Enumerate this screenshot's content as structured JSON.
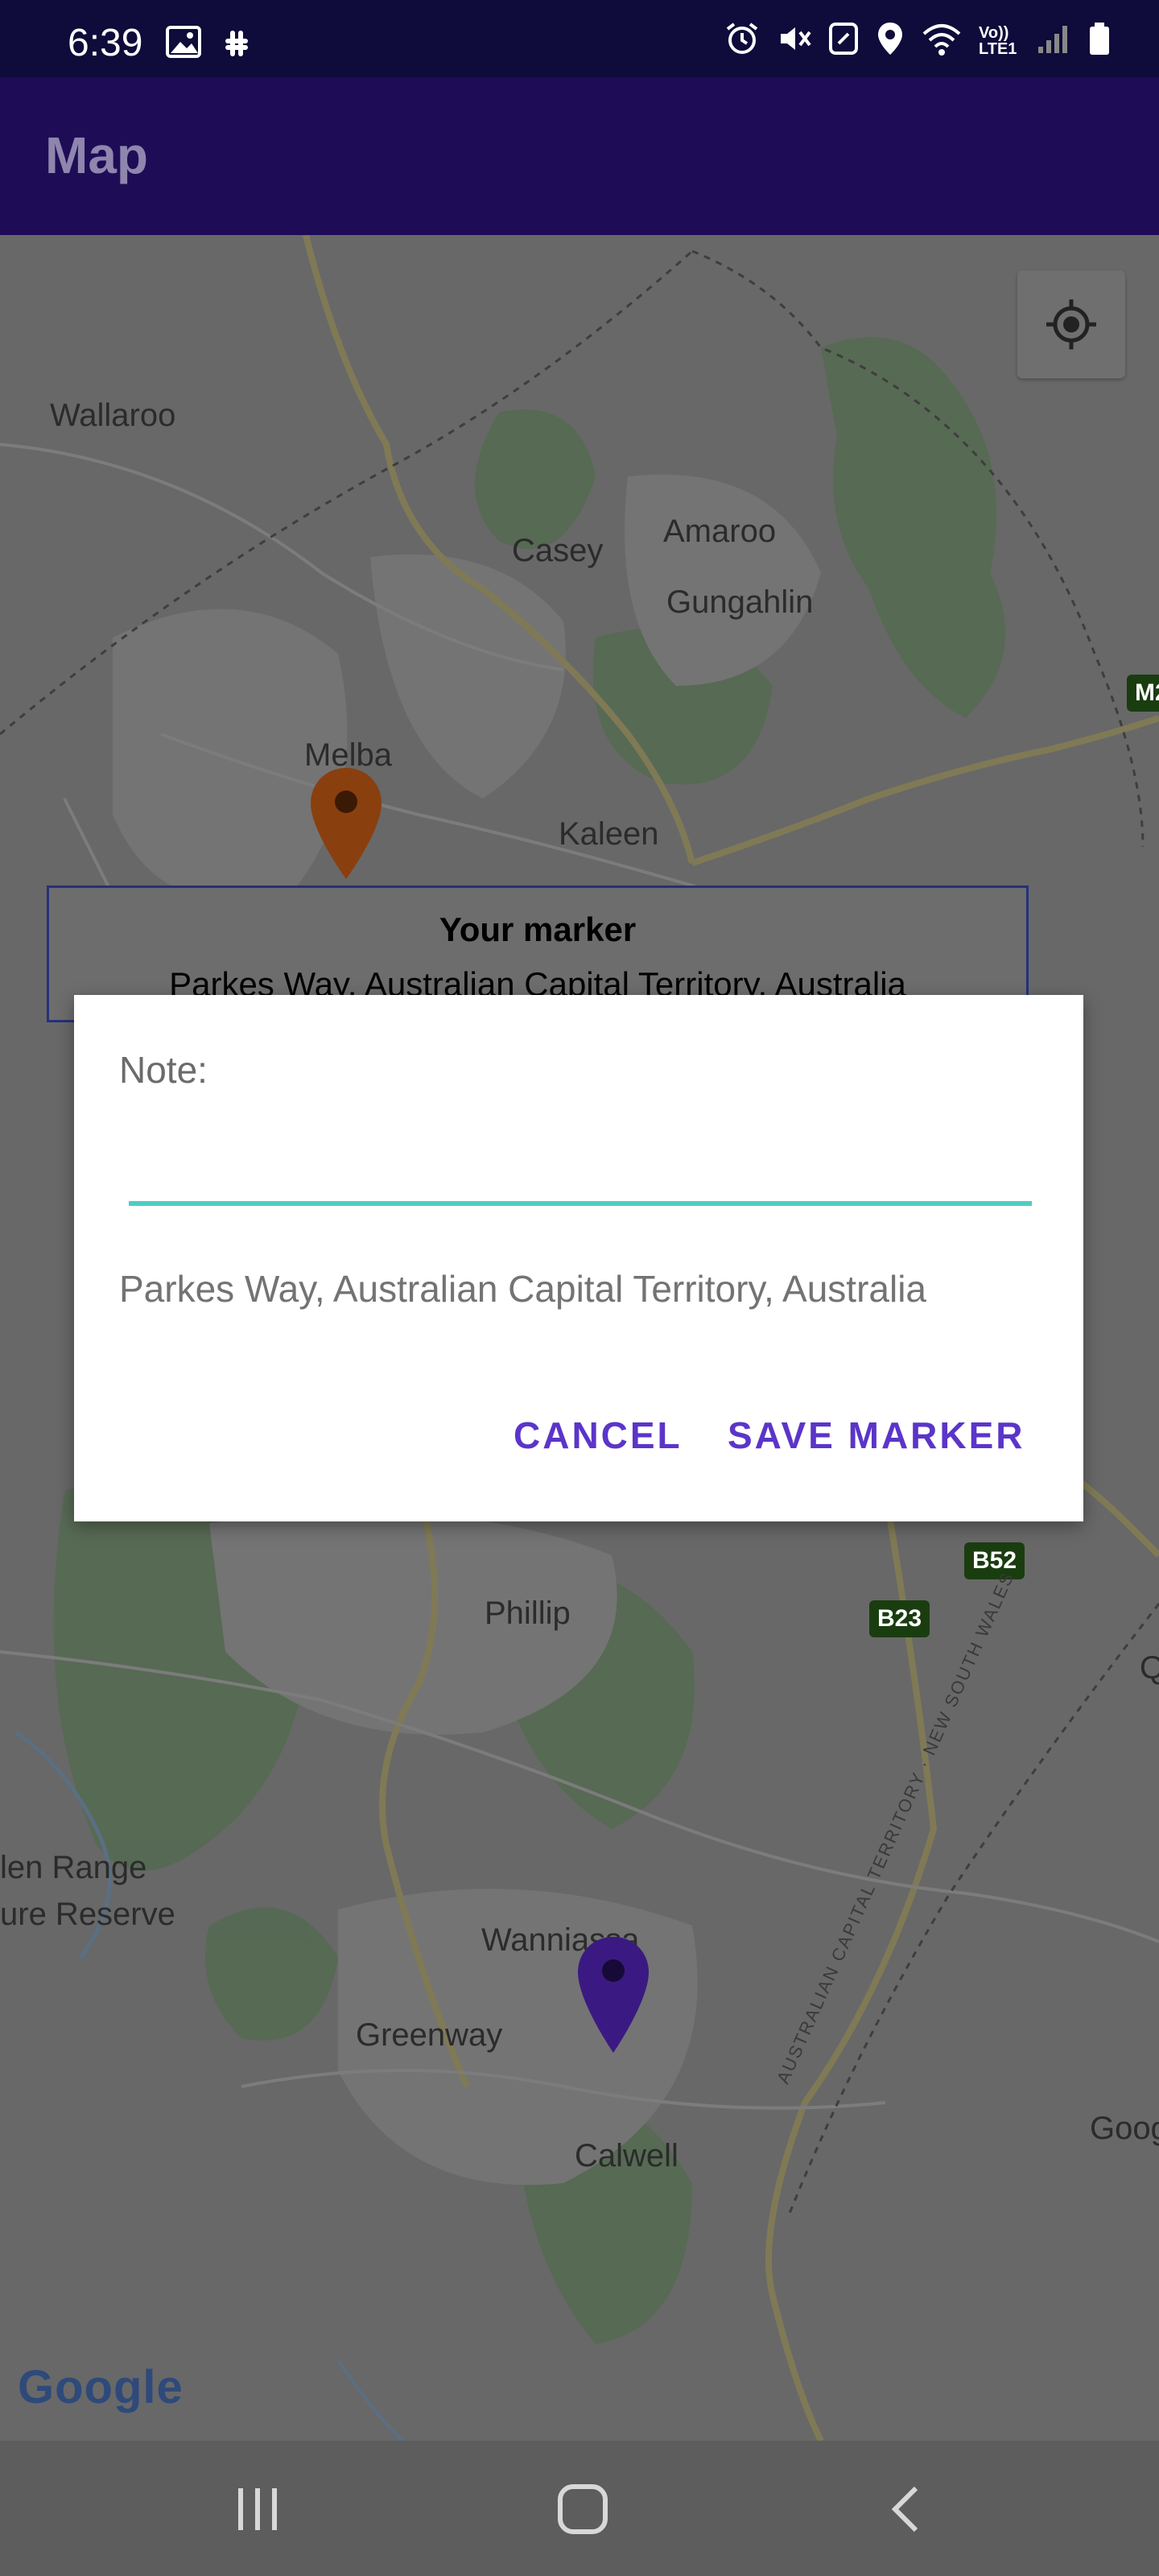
{
  "status_bar": {
    "time": "6:39",
    "left_icons": [
      "image-icon",
      "slack-icon"
    ],
    "right_icons": [
      "alarm-icon",
      "mute-icon",
      "nfc-icon",
      "location-icon",
      "wifi-icon",
      "volte-icon",
      "signal-icon",
      "battery-icon"
    ],
    "volte_text": "Vo)) LTE1"
  },
  "app_bar": {
    "title": "Map"
  },
  "map": {
    "labels": [
      "Wallaroo",
      "Casey",
      "Amaroo",
      "Gungahlin",
      "Melba",
      "Kaleen",
      "Phillip",
      "len Range",
      "ure Reserve",
      "Wanniassa",
      "Greenway",
      "Calwell",
      "Goog"
    ],
    "shields": [
      "M2",
      "B52",
      "B23"
    ],
    "border_label": "AUSTRALIAN CAPITAL TERRITORY · NEW SOUTH WALES",
    "q_label": "Q",
    "markers": [
      {
        "name": "orange",
        "color": "#8a3f0f"
      },
      {
        "name": "purple",
        "color": "#3a1a82"
      }
    ]
  },
  "info_window": {
    "title": "Your marker",
    "snippet": "Parkes Way, Australian Capital Territory, Australia"
  },
  "dialog": {
    "note_label": "Note:",
    "note_value": "",
    "note_placeholder": "",
    "address": "Parkes Way, Australian Capital Territory, Australia",
    "cancel_label": "CANCEL",
    "save_label": "SAVE MARKER",
    "accent_color": "#5b35c9",
    "input_underline_color": "#4ecdc4"
  },
  "google_logo": "Google",
  "nav_bar": {
    "buttons": [
      "recents-icon",
      "home-icon",
      "back-icon"
    ]
  }
}
